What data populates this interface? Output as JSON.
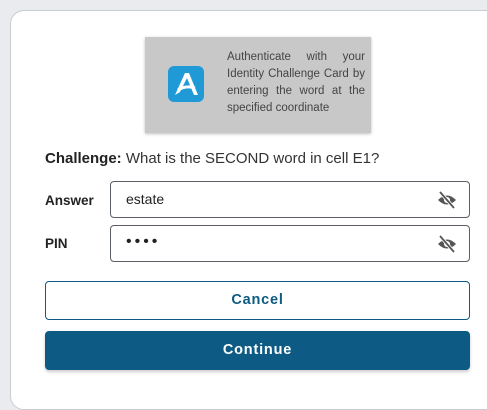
{
  "auth_card": {
    "logo_icon": "authenticator-logo-icon",
    "message": "Authenticate with your Identity Challenge Card by entering the word at the specified coordinate"
  },
  "challenge": {
    "label": "Challenge:",
    "question": " What is the SECOND word in cell E1?"
  },
  "answer": {
    "label": "Answer",
    "value": "estate",
    "toggle_icon": "eye-slash-icon"
  },
  "pin": {
    "label": "PIN",
    "value": "••••",
    "toggle_icon": "eye-slash-icon"
  },
  "buttons": {
    "cancel": "Cancel",
    "continue": "Continue"
  },
  "colors": {
    "primary": "#0d5b85",
    "logo": "#1f9ad6",
    "card_bg": "#c8c8c8"
  }
}
